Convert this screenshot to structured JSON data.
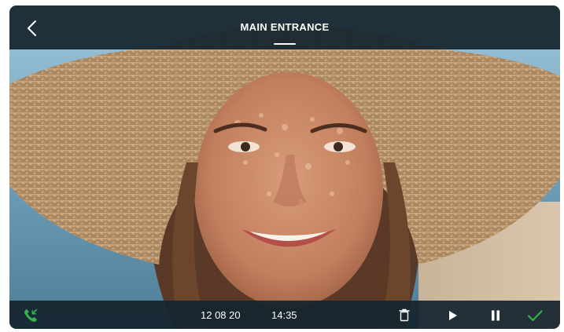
{
  "header": {
    "title": "MAIN ENTRANCE",
    "back_icon": "chevron-left-icon"
  },
  "video": {
    "subject": "live-camera-feed"
  },
  "footer": {
    "date": "12 08 20",
    "time": "14:35",
    "call_icon": "incoming-call-icon",
    "delete_icon": "trash-icon",
    "play_icon": "play-icon",
    "pause_icon": "pause-icon",
    "confirm_icon": "checkmark-icon"
  },
  "colors": {
    "bar_background": "#16252e",
    "accent_green": "#2fb54a",
    "text": "#ffffff"
  }
}
